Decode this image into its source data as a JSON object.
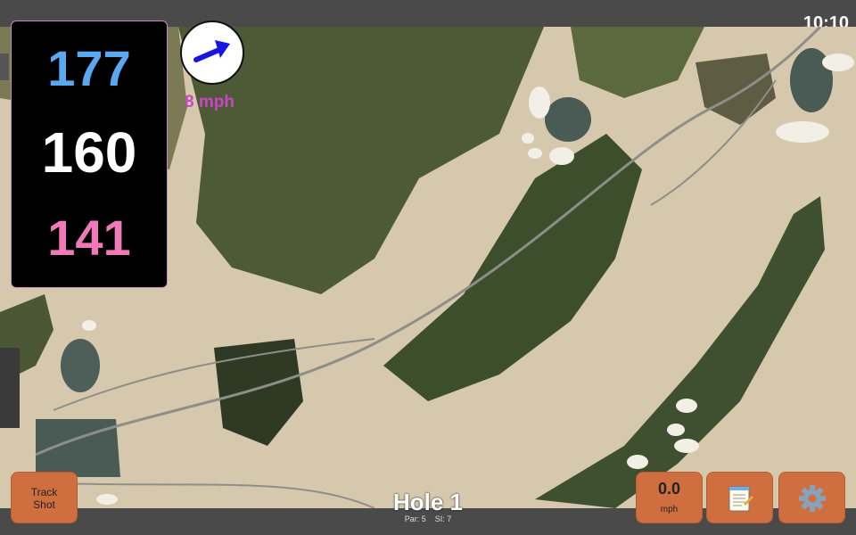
{
  "status": {
    "time": "10:10"
  },
  "distances": {
    "back": "177",
    "middle": "160",
    "front": "141"
  },
  "wind": {
    "speed_label": "8 mph",
    "icon": "wind-arrow-icon"
  },
  "hole": {
    "title": "Hole 1",
    "par_label": "Par: 5",
    "si_label": "SI: 7"
  },
  "buttons": {
    "track_shot_line1": "Track",
    "track_shot_line2": "Shot",
    "speed_value": "0.0",
    "speed_unit": "mph",
    "notes_icon": "notepad-icon",
    "settings_icon": "gear-icon"
  },
  "colors": {
    "back_distance": "#5aa9f0",
    "front_distance": "#f07ab8",
    "accent": "#cc44c8",
    "button": "#cf6e3e"
  }
}
